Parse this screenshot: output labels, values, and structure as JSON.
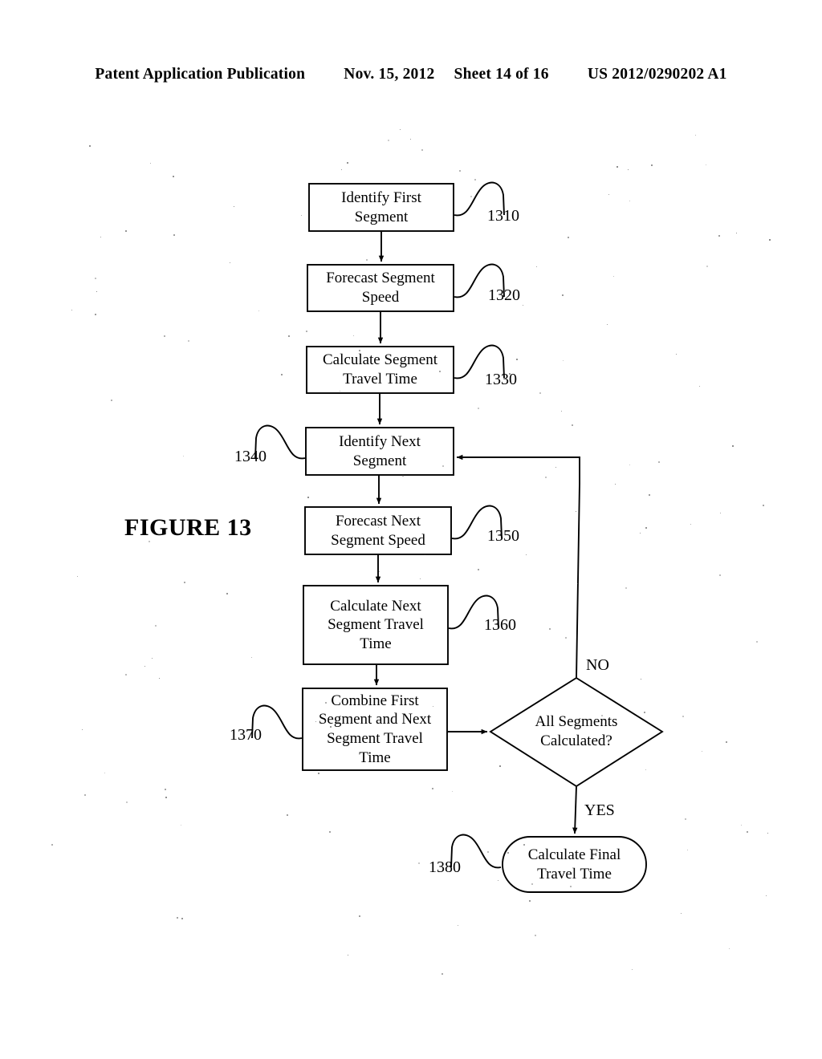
{
  "header": {
    "publication": "Patent Application Publication",
    "date": "Nov. 15, 2012",
    "sheet": "Sheet 14 of 16",
    "patent_number": "US 2012/0290202 A1"
  },
  "figure": {
    "caption": "FIGURE 13"
  },
  "flowchart": {
    "nodes": [
      {
        "id": "n1310",
        "ref": "1310",
        "shape": "rect",
        "text": "Identify First\nSegment"
      },
      {
        "id": "n1320",
        "ref": "1320",
        "shape": "rect",
        "text": "Forecast Segment\nSpeed"
      },
      {
        "id": "n1330",
        "ref": "1330",
        "shape": "rect",
        "text": "Calculate Segment\nTravel Time"
      },
      {
        "id": "n1340",
        "ref": "1340",
        "shape": "rect",
        "text": "Identify Next\nSegment"
      },
      {
        "id": "n1350",
        "ref": "1350",
        "shape": "rect",
        "text": "Forecast Next\nSegment Speed"
      },
      {
        "id": "n1360",
        "ref": "1360",
        "shape": "rect",
        "text": "Calculate Next\nSegment Travel\nTime"
      },
      {
        "id": "n1370",
        "ref": "1370",
        "shape": "rect",
        "text": "Combine First\nSegment and Next\nSegment Travel\nTime"
      },
      {
        "id": "ndec",
        "ref": "",
        "shape": "diamond",
        "text": "All Segments\nCalculated?"
      },
      {
        "id": "n1380",
        "ref": "1380",
        "shape": "rounded",
        "text": "Calculate Final\nTravel Time"
      }
    ],
    "lines": {
      "n1310": [
        "Identify First",
        "Segment"
      ],
      "n1320": [
        "Forecast Segment",
        "Speed"
      ],
      "n1330": [
        "Calculate Segment",
        "Travel Time"
      ],
      "n1340": [
        "Identify Next",
        "Segment"
      ],
      "n1350": [
        "Forecast Next",
        "Segment Speed"
      ],
      "n1360": [
        "Calculate Next",
        "Segment Travel",
        "Time"
      ],
      "n1370": [
        "Combine First",
        "Segment and Next",
        "Segment Travel",
        "Time"
      ],
      "ndec": [
        "All Segments",
        "Calculated?"
      ],
      "n1380": [
        "Calculate Final",
        "Travel Time"
      ]
    },
    "refs": {
      "r1310": "1310",
      "r1320": "1320",
      "r1330": "1330",
      "r1340": "1340",
      "r1350": "1350",
      "r1360": "1360",
      "r1370": "1370",
      "r1380": "1380"
    },
    "branches": {
      "no": "NO",
      "yes": "YES"
    }
  },
  "colors": {
    "ink": "#000000",
    "page": "#ffffff"
  }
}
